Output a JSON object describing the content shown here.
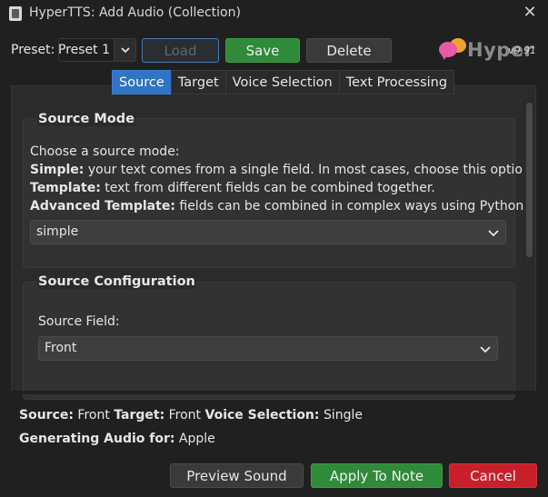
{
  "window": {
    "title": "HyperTTS: Add Audio (Collection)",
    "close_glyph": "✕"
  },
  "preset": {
    "label": "Preset:",
    "value": "Preset 1",
    "load_label": "Load",
    "save_label": "Save",
    "delete_label": "Delete"
  },
  "logo": {
    "text": "Hyper",
    "version": "v0.91"
  },
  "tabs": [
    {
      "label": "Source",
      "active": true
    },
    {
      "label": "Target",
      "active": false
    },
    {
      "label": "Voice Selection",
      "active": false
    },
    {
      "label": "Text Processing",
      "active": false
    }
  ],
  "source_mode": {
    "title": "Source Mode",
    "intro": "Choose a source mode:",
    "simple_label": "Simple:",
    "simple_desc": " your text comes from a single field. In most cases, choose this option.",
    "template_label": "Template:",
    "template_desc": " text from different fields can be combined together.",
    "advanced_label": "Advanced Template:",
    "advanced_desc": " fields can be combined in complex ways using Python.",
    "selected": "simple"
  },
  "source_config": {
    "title": "Source Configuration",
    "field_label": "Source Field:",
    "field_value": "Front"
  },
  "summary": {
    "source_label": "Source:",
    "source_value": " Front ",
    "target_label": "Target:",
    "target_value": " Front ",
    "voice_label": "Voice Selection:",
    "voice_value": " Single",
    "generating_label": "Generating Audio for:",
    "generating_value": " Apple"
  },
  "actions": {
    "preview_label": "Preview Sound",
    "apply_label": "Apply To Note",
    "cancel_label": "Cancel"
  },
  "colors": {
    "background": "#202020",
    "accent_blue": "#3173c4",
    "save_green": "#2f8a3a",
    "cancel_red": "#c8202a"
  }
}
